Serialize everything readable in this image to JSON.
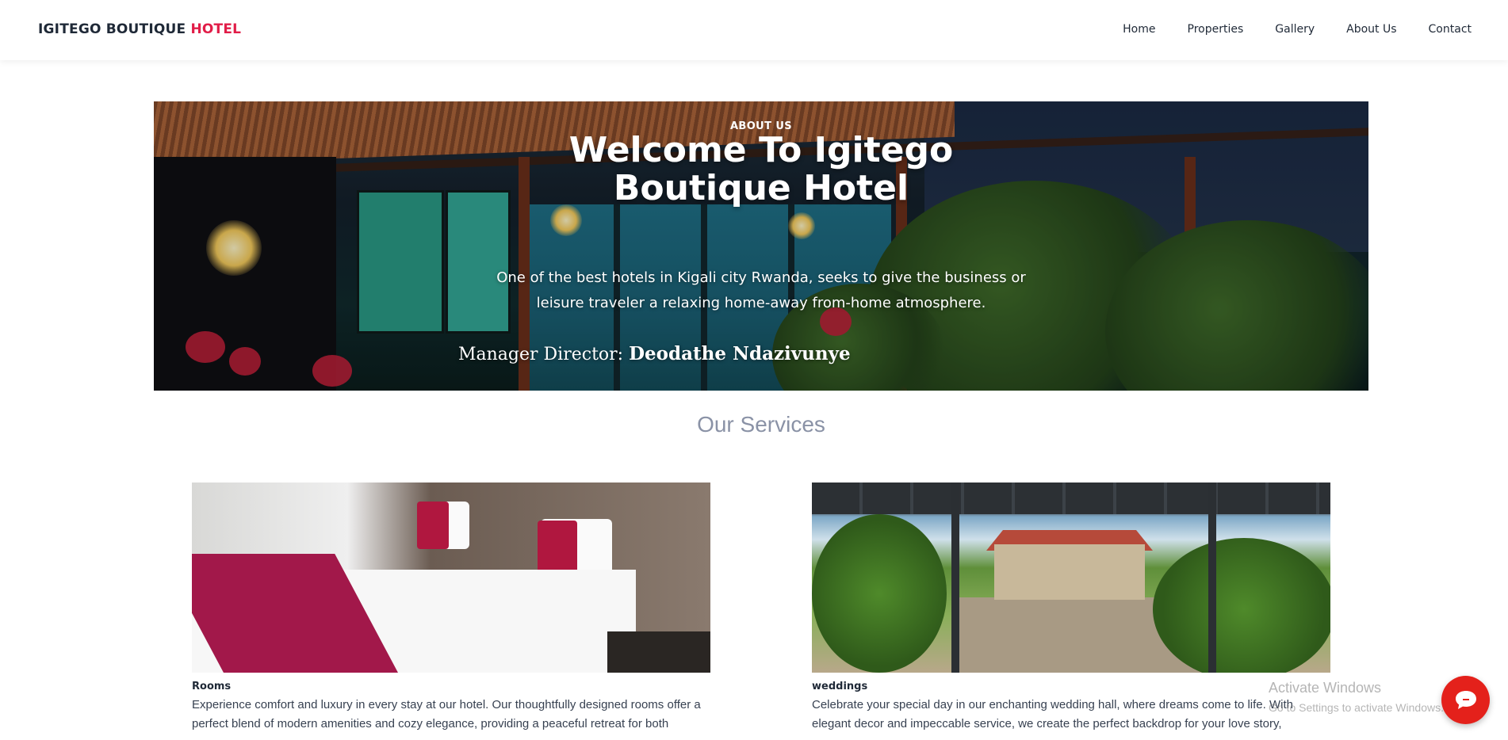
{
  "navbar": {
    "brand_main": "IGITEGO BOUTIQUE ",
    "brand_accent": "HOTEL",
    "links": [
      "Home",
      "Properties",
      "Gallery",
      "About Us",
      "Contact"
    ]
  },
  "hero": {
    "tag": "ABOUT US",
    "title": "Welcome To Igitego Boutique Hotel",
    "description": "One of the best hotels in Kigali city Rwanda, seeks to give the business or leisure traveler a relaxing home-away from-home atmosphere.",
    "manager_label": "Manager Director: ",
    "manager_name": "Deodathe Ndazivunye"
  },
  "services": {
    "title": "Our Services",
    "items": [
      {
        "name": "Rooms",
        "description": "Experience comfort and luxury in every stay at our hotel. Our thoughtfully designed rooms offer a perfect blend of modern amenities and cozy elegance, providing a peaceful retreat for both"
      },
      {
        "name": "weddings",
        "description": "Celebrate your special day in our enchanting wedding hall, where dreams come to life. With elegant decor and impeccable service, we create the perfect backdrop for your love story,"
      }
    ]
  },
  "watermark": {
    "line1": "Activate Windows",
    "line2": "Go to Settings to activate Windows."
  },
  "colors": {
    "accent": "#e11d48",
    "chat_button": "#e4211b",
    "services_title": "#8a92a6"
  },
  "chat": {
    "icon": "chat-bubble-icon"
  }
}
